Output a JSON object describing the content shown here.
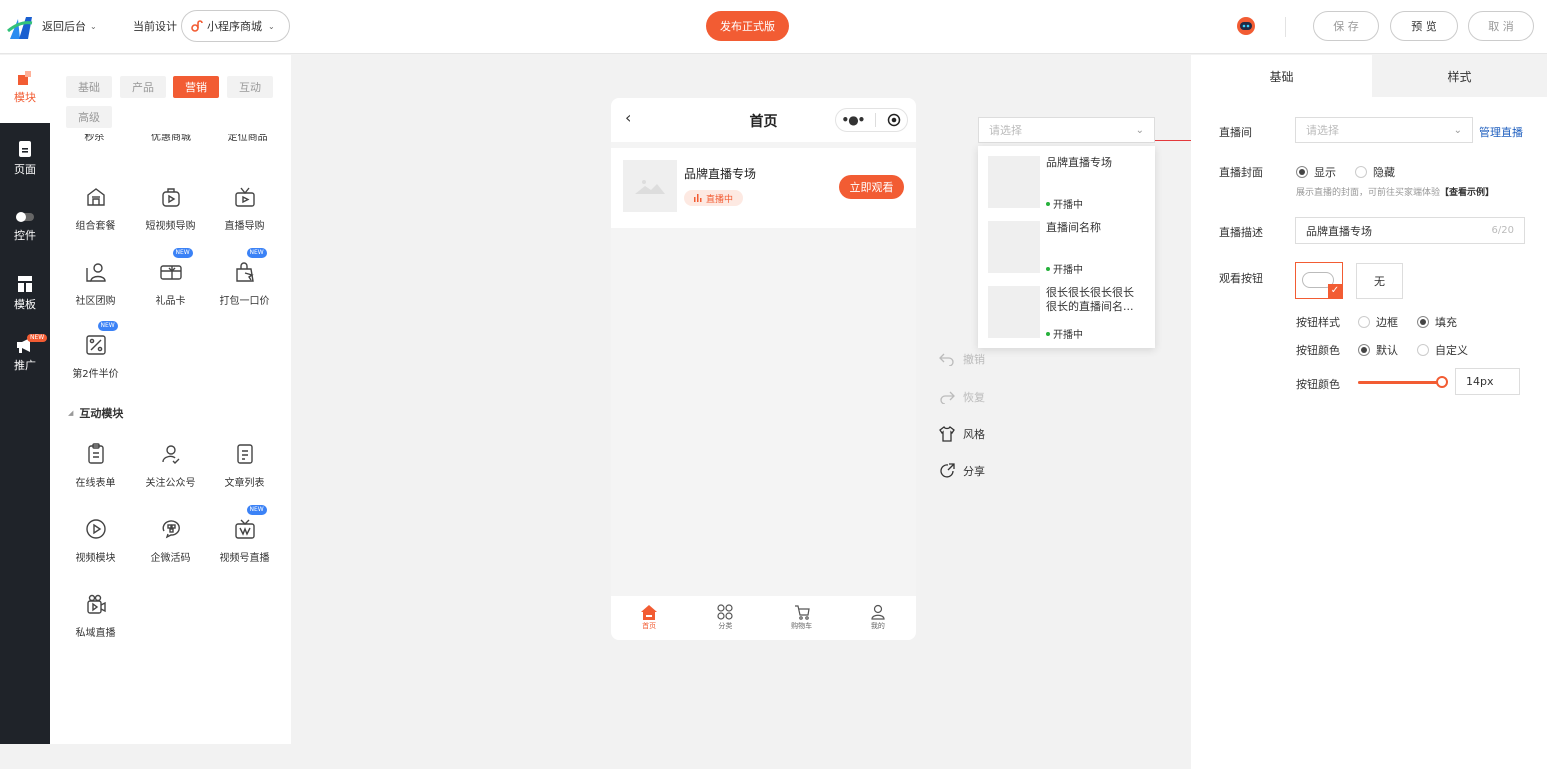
{
  "topbar": {
    "back_label": "返回后台",
    "current_design_label": "当前设计",
    "design_select_value": "小程序商城",
    "publish_label": "发布正式版",
    "save_label": "保 存",
    "preview_label": "预 览",
    "cancel_label": "取 消"
  },
  "rail": {
    "items": [
      {
        "label": "模块",
        "icon": "module-icon"
      },
      {
        "label": "页面",
        "icon": "page-icon"
      },
      {
        "label": "控件",
        "icon": "toggle-icon"
      },
      {
        "label": "模板",
        "icon": "template-icon"
      },
      {
        "label": "推广",
        "icon": "megaphone-icon",
        "badge": "NEW"
      }
    ]
  },
  "palette": {
    "categories": [
      "基础",
      "产品",
      "营销",
      "互动",
      "高级"
    ],
    "active_category": "营销",
    "partial_row": [
      "秒杀",
      "优惠商城",
      "定位商品"
    ],
    "marketing": [
      {
        "label": "组合套餐",
        "icon": "combo-icon"
      },
      {
        "label": "短视频导购",
        "icon": "short-video-icon"
      },
      {
        "label": "直播导购",
        "icon": "live-tv-icon"
      },
      {
        "label": "社区团购",
        "icon": "community-icon"
      },
      {
        "label": "礼品卡",
        "icon": "gift-card-icon",
        "badge": "NEW"
      },
      {
        "label": "打包一口价",
        "icon": "bundle-icon",
        "badge": "NEW"
      },
      {
        "label": "第2件半价",
        "icon": "percent-icon",
        "badge": "NEW"
      }
    ],
    "interaction_title": "互动模块",
    "interaction": [
      {
        "label": "在线表单",
        "icon": "clipboard-icon"
      },
      {
        "label": "关注公众号",
        "icon": "follow-user-icon"
      },
      {
        "label": "文章列表",
        "icon": "article-icon"
      },
      {
        "label": "视频模块",
        "icon": "play-circle-icon"
      },
      {
        "label": "企微活码",
        "icon": "wecom-icon"
      },
      {
        "label": "视频号直播",
        "icon": "channel-live-icon",
        "badge": "NEW"
      },
      {
        "label": "私域直播",
        "icon": "private-live-icon"
      }
    ]
  },
  "phone": {
    "title": "首页",
    "live_card": {
      "name": "品牌直播专场",
      "status": "直播中",
      "watch_button": "立即观看"
    },
    "nav": [
      "首页",
      "分类",
      "购物车",
      "我的"
    ]
  },
  "dropdown": {
    "placeholder": "请选择",
    "options": [
      {
        "name": "品牌直播专场",
        "status": "开播中"
      },
      {
        "name": "直播间名称",
        "status": "开播中"
      },
      {
        "name": "很长很长很长很长很长的直播间名...",
        "status": "开播中"
      }
    ]
  },
  "actions": {
    "undo": "撤销",
    "redo": "恢复",
    "style": "风格",
    "share": "分享"
  },
  "settings": {
    "tabs": [
      "基础",
      "样式"
    ],
    "active_tab": "基础",
    "live_room_label": "直播间",
    "live_room_placeholder": "请选择",
    "manage_live_link": "管理直播",
    "cover_label": "直播封面",
    "cover_show": "显示",
    "cover_hide": "隐藏",
    "cover_hint": "展示直播的封面，可前往买家端体验",
    "cover_example_link": "【查看示例】",
    "desc_label": "直播描述",
    "desc_value": "品牌直播专场",
    "desc_count": "6/20",
    "watch_button_label": "观看按钮",
    "watch_button_none": "无",
    "button_style_label": "按钮样式",
    "button_style_outline": "边框",
    "button_style_fill": "填充",
    "button_color_label": "按钮颜色",
    "button_color_default": "默认",
    "button_color_custom": "自定义",
    "button_size_label": "按钮颜色",
    "button_size_value": "14px",
    "button_size_fraction": 1.0
  },
  "colors": {
    "accent": "#f25c33",
    "link": "#1f5fbf",
    "rail": "#1f2329"
  }
}
